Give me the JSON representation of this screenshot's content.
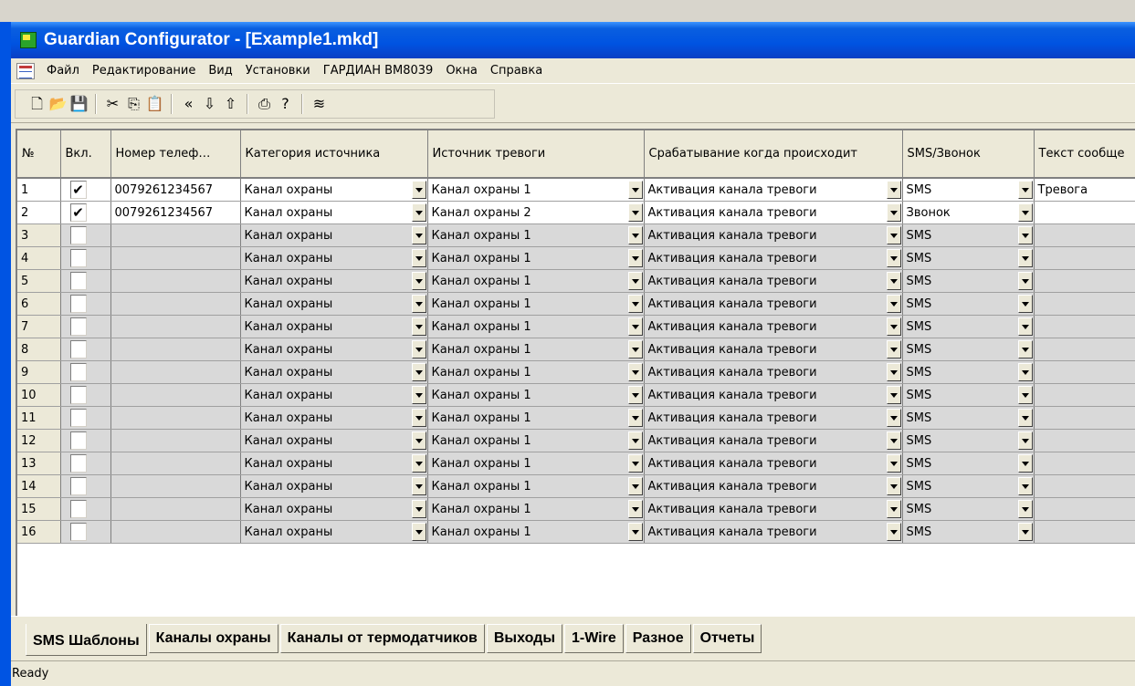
{
  "window": {
    "title": "Guardian Configurator - [Example1.mkd]"
  },
  "menu": [
    "Файл",
    "Редактирование",
    "Вид",
    "Установки",
    "ГАРДИАН BM8039",
    "Окна",
    "Справка"
  ],
  "toolbar": {
    "buttons": [
      {
        "name": "new-icon",
        "glyph": "🗋"
      },
      {
        "name": "open-icon",
        "glyph": "📂"
      },
      {
        "name": "save-icon",
        "glyph": "💾"
      },
      {
        "sep": true
      },
      {
        "name": "cut-icon",
        "glyph": "✂"
      },
      {
        "name": "copy-icon",
        "glyph": "⎘"
      },
      {
        "name": "paste-icon",
        "glyph": "📋"
      },
      {
        "sep": true
      },
      {
        "name": "back-icon",
        "glyph": "«"
      },
      {
        "name": "download-icon",
        "glyph": "⇩"
      },
      {
        "name": "upload-icon",
        "glyph": "⇧"
      },
      {
        "sep": true
      },
      {
        "name": "print-icon",
        "glyph": "⎙"
      },
      {
        "name": "help-icon",
        "glyph": "?"
      },
      {
        "sep": true
      },
      {
        "name": "config-icon",
        "glyph": "≋"
      }
    ]
  },
  "table": {
    "columns": [
      "№",
      "Вкл.",
      "Номер телеф…",
      "Категория источника",
      "Источник тревоги",
      "Срабатывание когда происходит",
      "SMS/Звонок",
      "Текст сообще"
    ],
    "rows": [
      {
        "n": "1",
        "checked": true,
        "phone": "0079261234567",
        "category": "Канал охраны",
        "source": "Канал охраны 1",
        "trigger": "Активация канала тревоги",
        "mode": "SMS",
        "text": "Тревога"
      },
      {
        "n": "2",
        "checked": true,
        "phone": "0079261234567",
        "category": "Канал охраны",
        "source": "Канал охраны 2",
        "trigger": "Активация канала тревоги",
        "mode": "Звонок",
        "text": ""
      },
      {
        "n": "3",
        "checked": false,
        "phone": "",
        "category": "Канал охраны",
        "source": "Канал охраны 1",
        "trigger": "Активация канала тревоги",
        "mode": "SMS",
        "text": ""
      },
      {
        "n": "4",
        "checked": false,
        "phone": "",
        "category": "Канал охраны",
        "source": "Канал охраны 1",
        "trigger": "Активация канала тревоги",
        "mode": "SMS",
        "text": ""
      },
      {
        "n": "5",
        "checked": false,
        "phone": "",
        "category": "Канал охраны",
        "source": "Канал охраны 1",
        "trigger": "Активация канала тревоги",
        "mode": "SMS",
        "text": ""
      },
      {
        "n": "6",
        "checked": false,
        "phone": "",
        "category": "Канал охраны",
        "source": "Канал охраны 1",
        "trigger": "Активация канала тревоги",
        "mode": "SMS",
        "text": ""
      },
      {
        "n": "7",
        "checked": false,
        "phone": "",
        "category": "Канал охраны",
        "source": "Канал охраны 1",
        "trigger": "Активация канала тревоги",
        "mode": "SMS",
        "text": ""
      },
      {
        "n": "8",
        "checked": false,
        "phone": "",
        "category": "Канал охраны",
        "source": "Канал охраны 1",
        "trigger": "Активация канала тревоги",
        "mode": "SMS",
        "text": ""
      },
      {
        "n": "9",
        "checked": false,
        "phone": "",
        "category": "Канал охраны",
        "source": "Канал охраны 1",
        "trigger": "Активация канала тревоги",
        "mode": "SMS",
        "text": ""
      },
      {
        "n": "10",
        "checked": false,
        "phone": "",
        "category": "Канал охраны",
        "source": "Канал охраны 1",
        "trigger": "Активация канала тревоги",
        "mode": "SMS",
        "text": ""
      },
      {
        "n": "11",
        "checked": false,
        "phone": "",
        "category": "Канал охраны",
        "source": "Канал охраны 1",
        "trigger": "Активация канала тревоги",
        "mode": "SMS",
        "text": ""
      },
      {
        "n": "12",
        "checked": false,
        "phone": "",
        "category": "Канал охраны",
        "source": "Канал охраны 1",
        "trigger": "Активация канала тревоги",
        "mode": "SMS",
        "text": ""
      },
      {
        "n": "13",
        "checked": false,
        "phone": "",
        "category": "Канал охраны",
        "source": "Канал охраны 1",
        "trigger": "Активация канала тревоги",
        "mode": "SMS",
        "text": ""
      },
      {
        "n": "14",
        "checked": false,
        "phone": "",
        "category": "Канал охраны",
        "source": "Канал охраны 1",
        "trigger": "Активация канала тревоги",
        "mode": "SMS",
        "text": ""
      },
      {
        "n": "15",
        "checked": false,
        "phone": "",
        "category": "Канал охраны",
        "source": "Канал охраны 1",
        "trigger": "Активация канала тревоги",
        "mode": "SMS",
        "text": ""
      },
      {
        "n": "16",
        "checked": false,
        "phone": "",
        "category": "Канал охраны",
        "source": "Канал охраны 1",
        "trigger": "Активация канала тревоги",
        "mode": "SMS",
        "text": ""
      }
    ]
  },
  "tabs": [
    {
      "label": "SMS Шаблоны",
      "active": true
    },
    {
      "label": "Каналы охраны",
      "active": false
    },
    {
      "label": "Каналы от термодатчиков",
      "active": false
    },
    {
      "label": "Выходы",
      "active": false
    },
    {
      "label": "1-Wire",
      "active": false
    },
    {
      "label": "Разное",
      "active": false
    },
    {
      "label": "Отчеты",
      "active": false
    }
  ],
  "status": {
    "text": "Ready"
  },
  "colors": {
    "titlebar": "#0053e1",
    "chrome": "#ece9d8",
    "disabled_cell": "#d9d9d9"
  }
}
